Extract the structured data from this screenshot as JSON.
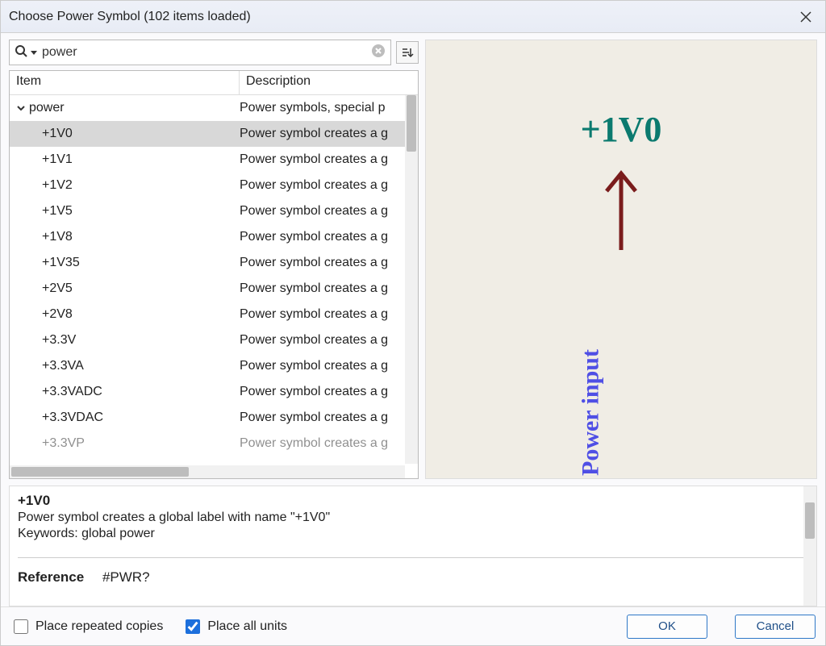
{
  "title": "Choose Power Symbol (102 items loaded)",
  "search": {
    "value": "power",
    "placeholder": ""
  },
  "columns": {
    "item": "Item",
    "desc": "Description"
  },
  "tree": {
    "parent": {
      "name": "power",
      "desc": "Power symbols, special p"
    },
    "children": [
      {
        "name": "+1V0",
        "desc": "Power symbol creates a g",
        "selected": true
      },
      {
        "name": "+1V1",
        "desc": "Power symbol creates a g"
      },
      {
        "name": "+1V2",
        "desc": "Power symbol creates a g"
      },
      {
        "name": "+1V5",
        "desc": "Power symbol creates a g"
      },
      {
        "name": "+1V8",
        "desc": "Power symbol creates a g"
      },
      {
        "name": "+1V35",
        "desc": "Power symbol creates a g"
      },
      {
        "name": "+2V5",
        "desc": "Power symbol creates a g"
      },
      {
        "name": "+2V8",
        "desc": "Power symbol creates a g"
      },
      {
        "name": "+3.3V",
        "desc": "Power symbol creates a g"
      },
      {
        "name": "+3.3VA",
        "desc": "Power symbol creates a g"
      },
      {
        "name": "+3.3VADC",
        "desc": "Power symbol creates a g"
      },
      {
        "name": "+3.3VDAC",
        "desc": "Power symbol creates a g"
      },
      {
        "name": "+3.3VP",
        "desc": "Power symbol creates a g"
      }
    ]
  },
  "preview": {
    "symbol_name": "+1V0",
    "pin_label": "Power input"
  },
  "details": {
    "title": "+1V0",
    "line1": "Power symbol creates a global label with name \"+1V0\"",
    "line2": "Keywords: global power",
    "ref_label": "Reference",
    "ref_value": "#PWR?"
  },
  "footer": {
    "repeated": "Place repeated copies",
    "all_units": "Place all units",
    "ok": "OK",
    "cancel": "Cancel"
  }
}
